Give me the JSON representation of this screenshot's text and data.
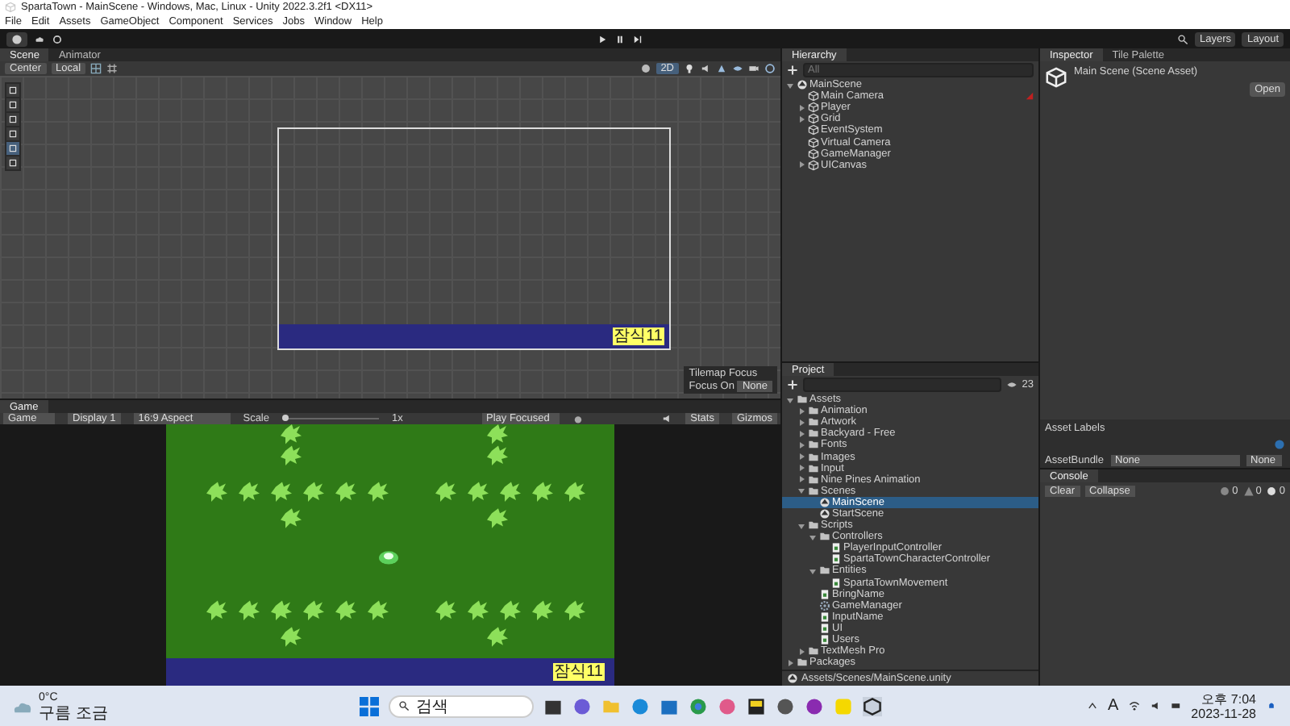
{
  "window": {
    "title": "SpartaTown - MainScene - Windows, Mac, Linux - Unity 2022.3.2f1 <DX11>"
  },
  "menu": [
    "File",
    "Edit",
    "Assets",
    "GameObject",
    "Component",
    "Services",
    "Jobs",
    "Window",
    "Help"
  ],
  "toolbar": {
    "layers": "Layers",
    "layout": "Layout"
  },
  "scene_panel": {
    "tabs": [
      {
        "label": "Scene",
        "selected": true
      },
      {
        "label": "Animator",
        "selected": false
      }
    ],
    "pivot": "Center",
    "space": "Local",
    "mode_2d": {
      "label": "2D",
      "selected": true
    },
    "tools": [
      {
        "selected": false
      },
      {
        "selected": false
      },
      {
        "selected": false
      },
      {
        "selected": false
      },
      {
        "selected": true
      },
      {
        "selected": false
      }
    ],
    "label": "잠식11",
    "tilemap_focus": {
      "title": "Tilemap Focus",
      "focus_on": "Focus On",
      "value": "None"
    }
  },
  "game_panel": {
    "tab": "Game",
    "view": "Game",
    "display": "Display 1",
    "aspect": "16:9 Aspect",
    "scale_label": "Scale",
    "scale_value": "1x",
    "scale_slider": {
      "level": 0
    },
    "play_mode": "Play Focused",
    "stats": "Stats",
    "gizmos": "Gizmos",
    "label": "잠식11"
  },
  "hierarchy": {
    "title": "Hierarchy",
    "search_placeholder": "All",
    "items": [
      {
        "label": "MainScene",
        "kind": "scene",
        "expanded": true,
        "selected": false,
        "children": [
          {
            "label": "Main Camera",
            "kind": "object",
            "selected": false
          },
          {
            "label": "Player",
            "kind": "object",
            "expanded": false,
            "selected": false
          },
          {
            "label": "Grid",
            "kind": "object",
            "expanded": false,
            "selected": false
          },
          {
            "label": "EventSystem",
            "kind": "object",
            "selected": false
          },
          {
            "label": "Virtual Camera",
            "kind": "object",
            "selected": false
          },
          {
            "label": "GameManager",
            "kind": "object",
            "selected": false
          },
          {
            "label": "UICanvas",
            "kind": "object",
            "expanded": false,
            "selected": false
          }
        ]
      }
    ]
  },
  "inspector": {
    "tabs": [
      {
        "label": "Inspector",
        "selected": true
      },
      {
        "label": "Tile Palette",
        "selected": false
      }
    ],
    "asset_title": "Main Scene (Scene Asset)",
    "open_button": "Open",
    "asset_labels": "Asset Labels",
    "asset_bundle": "AssetBundle",
    "bundle_value": "None",
    "variant_value": "None"
  },
  "console": {
    "title": "Console",
    "clear": "Clear",
    "collapse": "Collapse",
    "errors": "0",
    "warnings": "0",
    "messages": "0"
  },
  "project": {
    "title": "Project",
    "count": "23",
    "path": "Assets/Scenes/MainScene.unity",
    "items": [
      {
        "label": "Assets",
        "kind": "folder",
        "expanded": true,
        "selected": false,
        "children": [
          {
            "label": "Animation",
            "kind": "folder",
            "expanded": false,
            "selected": false
          },
          {
            "label": "Artwork",
            "kind": "folder",
            "expanded": false,
            "selected": false
          },
          {
            "label": "Backyard - Free",
            "kind": "folder",
            "expanded": false,
            "selected": false
          },
          {
            "label": "Fonts",
            "kind": "folder",
            "expanded": false,
            "selected": false
          },
          {
            "label": "Images",
            "kind": "folder",
            "expanded": false,
            "selected": false
          },
          {
            "label": "Input",
            "kind": "folder",
            "expanded": false,
            "selected": false
          },
          {
            "label": "Nine Pines Animation",
            "kind": "folder",
            "expanded": false,
            "selected": false
          },
          {
            "label": "Scenes",
            "kind": "folder",
            "expanded": true,
            "selected": false,
            "children": [
              {
                "label": "MainScene",
                "kind": "scene",
                "selected": true
              },
              {
                "label": "StartScene",
                "kind": "scene",
                "selected": false
              }
            ]
          },
          {
            "label": "Scripts",
            "kind": "folder",
            "expanded": true,
            "selected": false,
            "children": [
              {
                "label": "Controllers",
                "kind": "folder",
                "expanded": true,
                "selected": false,
                "children": [
                  {
                    "label": "PlayerInputController",
                    "kind": "script",
                    "selected": false
                  },
                  {
                    "label": "SpartaTownCharacterController",
                    "kind": "script",
                    "selected": false
                  }
                ]
              },
              {
                "label": "Entities",
                "kind": "folder",
                "expanded": true,
                "selected": false,
                "children": [
                  {
                    "label": "SpartaTownMovement",
                    "kind": "script",
                    "selected": false
                  }
                ]
              },
              {
                "label": "BringName",
                "kind": "script",
                "selected": false
              },
              {
                "label": "GameManager",
                "kind": "gear",
                "selected": false
              },
              {
                "label": "InputName",
                "kind": "script",
                "selected": false
              },
              {
                "label": "UI",
                "kind": "script",
                "selected": false
              },
              {
                "label": "Users",
                "kind": "script",
                "selected": false
              }
            ]
          },
          {
            "label": "TextMesh Pro",
            "kind": "folder",
            "expanded": false,
            "selected": false
          }
        ]
      },
      {
        "label": "Packages",
        "kind": "folder",
        "expanded": false,
        "selected": false
      }
    ]
  },
  "taskbar": {
    "temperature": "0°C",
    "weather": "구름 조금",
    "search_placeholder": "검색",
    "ime": "A",
    "time": "오후 7:04",
    "date": "2023-11-28"
  }
}
